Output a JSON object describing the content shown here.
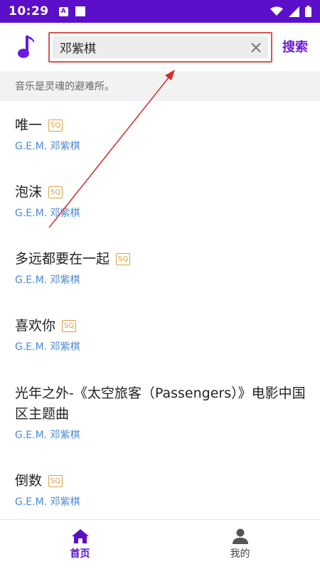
{
  "status_bar": {
    "time": "10:29",
    "notification_letter": "A"
  },
  "header": {
    "search_value": "邓紫棋",
    "search_button_label": "搜索"
  },
  "slogan": "音乐是灵魂的避难所。",
  "badge_label": "SQ",
  "songs": [
    {
      "title": "唯一",
      "artist": "G.E.M. 邓紫棋"
    },
    {
      "title": "泡沫",
      "artist": "G.E.M. 邓紫棋"
    },
    {
      "title": "多远都要在一起",
      "artist": "G.E.M. 邓紫棋"
    },
    {
      "title": "喜欢你",
      "artist": "G.E.M. 邓紫棋"
    },
    {
      "title": "光年之外-《太空旅客（Passengers）》电影中国区主题曲",
      "artist": "G.E.M. 邓紫棋"
    },
    {
      "title": "倒数",
      "artist": "G.E.M. 邓紫棋"
    }
  ],
  "bottom_nav": {
    "home_label": "首页",
    "mine_label": "我的"
  },
  "colors": {
    "accent": "#5b0fc8",
    "artist": "#4a8ad6",
    "badge": "#d9a241",
    "annotation": "#d32f2f"
  }
}
